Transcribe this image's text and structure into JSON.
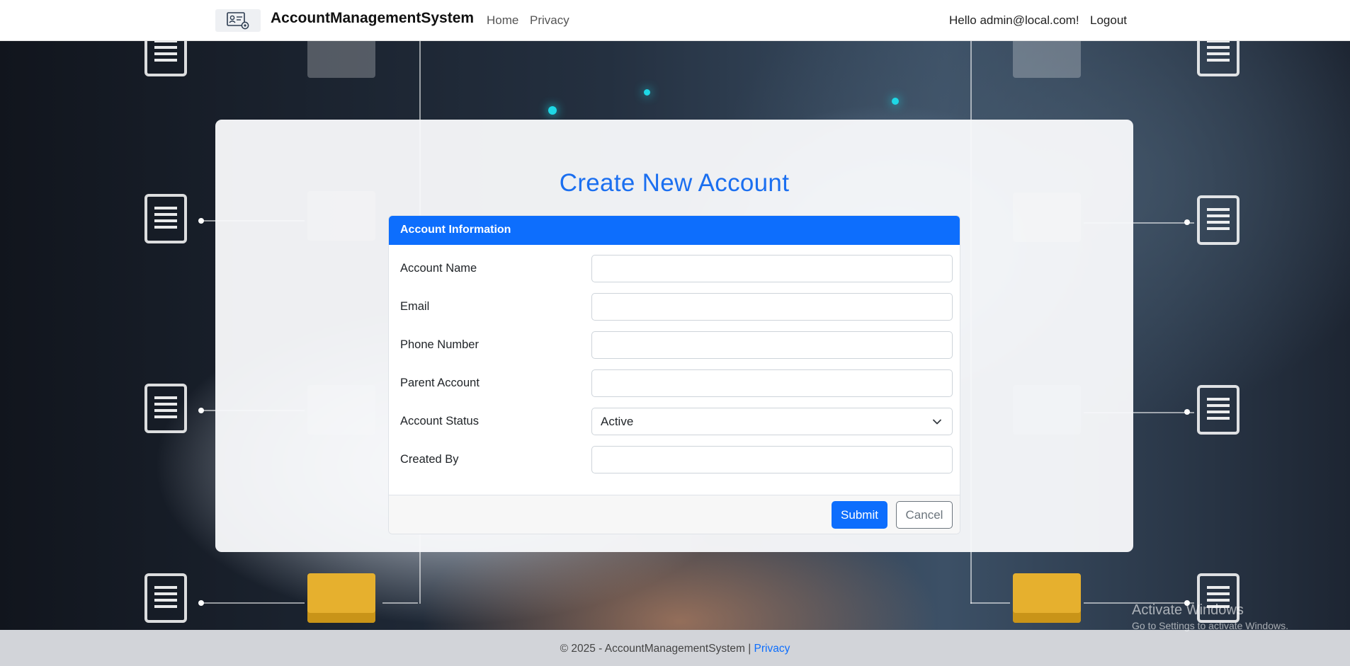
{
  "navbar": {
    "brand": "AccountManagementSystem",
    "links": [
      {
        "label": "Home"
      },
      {
        "label": "Privacy"
      }
    ],
    "greeting": "Hello admin@local.com!",
    "logout_label": "Logout"
  },
  "page": {
    "title": "Create New Account"
  },
  "form": {
    "section_title": "Account Information",
    "fields": [
      {
        "label": "Account Name",
        "value": ""
      },
      {
        "label": "Email",
        "value": ""
      },
      {
        "label": "Phone Number",
        "value": ""
      },
      {
        "label": "Parent Account",
        "value": ""
      },
      {
        "label": "Account Status",
        "value": "Active"
      },
      {
        "label": "Created By",
        "value": ""
      }
    ],
    "submit_label": "Submit",
    "cancel_label": "Cancel"
  },
  "footer": {
    "text": "© 2025 - AccountManagementSystem | ",
    "privacy_link": "Privacy"
  },
  "watermark": {
    "title": "Activate Windows",
    "subtitle": "Go to Settings to activate Windows."
  },
  "colors": {
    "primary": "#0d6efd",
    "title_blue": "#1b6ff0",
    "card_bg": "#f8f9fb",
    "folder_yellow": "#e6b02e"
  }
}
